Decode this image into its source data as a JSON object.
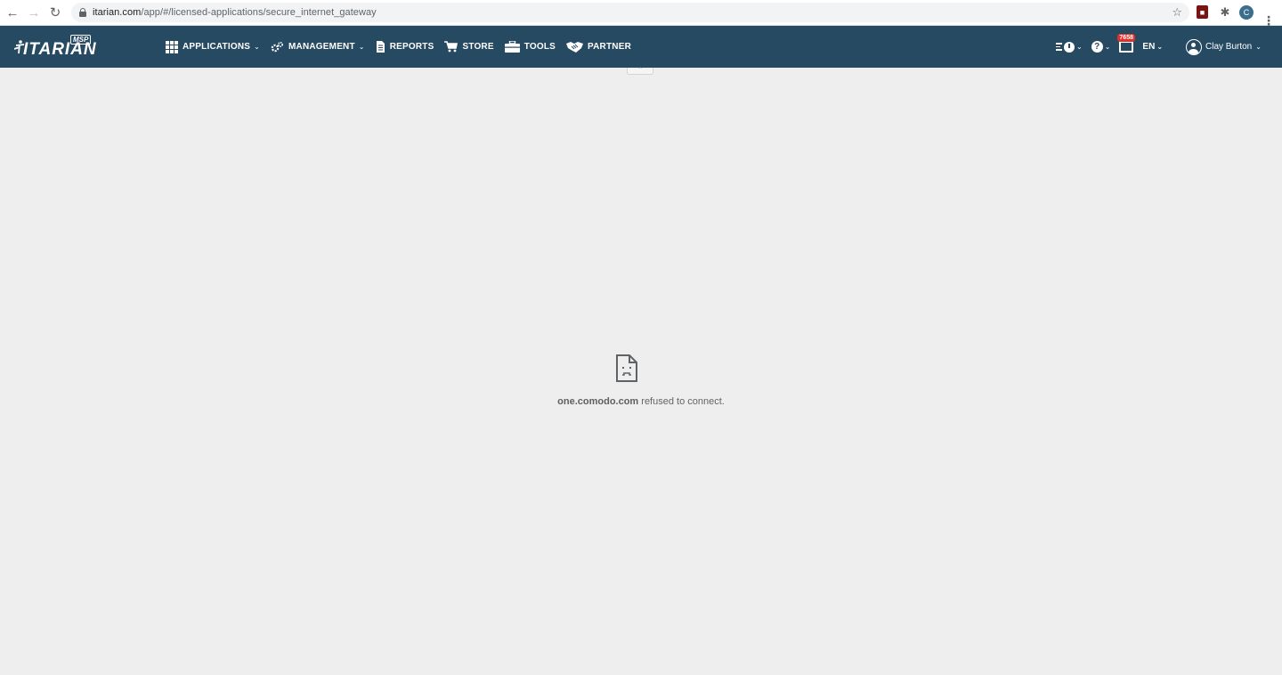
{
  "browser": {
    "url_host": "itarian.com",
    "url_path": "/app/#/licensed-applications/secure_internet_gateway",
    "profile_initial": "C"
  },
  "app": {
    "logo_text": "ITARIAN",
    "logo_badge": "MSP",
    "menu": [
      {
        "label": "APPLICATIONS",
        "icon": "grid-icon",
        "caret": true
      },
      {
        "label": "MANAGEMENT",
        "icon": "gear-icon",
        "caret": true
      },
      {
        "label": "REPORTS",
        "icon": "document-icon",
        "caret": false
      },
      {
        "label": "STORE",
        "icon": "cart-icon",
        "caret": false
      },
      {
        "label": "TOOLS",
        "icon": "toolbox-icon",
        "caret": false
      },
      {
        "label": "PARTNER",
        "icon": "handshake-icon",
        "caret": false
      }
    ],
    "notification_count": "7658",
    "language": "EN",
    "user_name": "Clay Burton"
  },
  "error": {
    "host": "one.comodo.com",
    "message": " refused to connect."
  },
  "colors": {
    "header_bg": "#264a62",
    "page_bg": "#eeeeee",
    "badge": "#d9342b"
  }
}
